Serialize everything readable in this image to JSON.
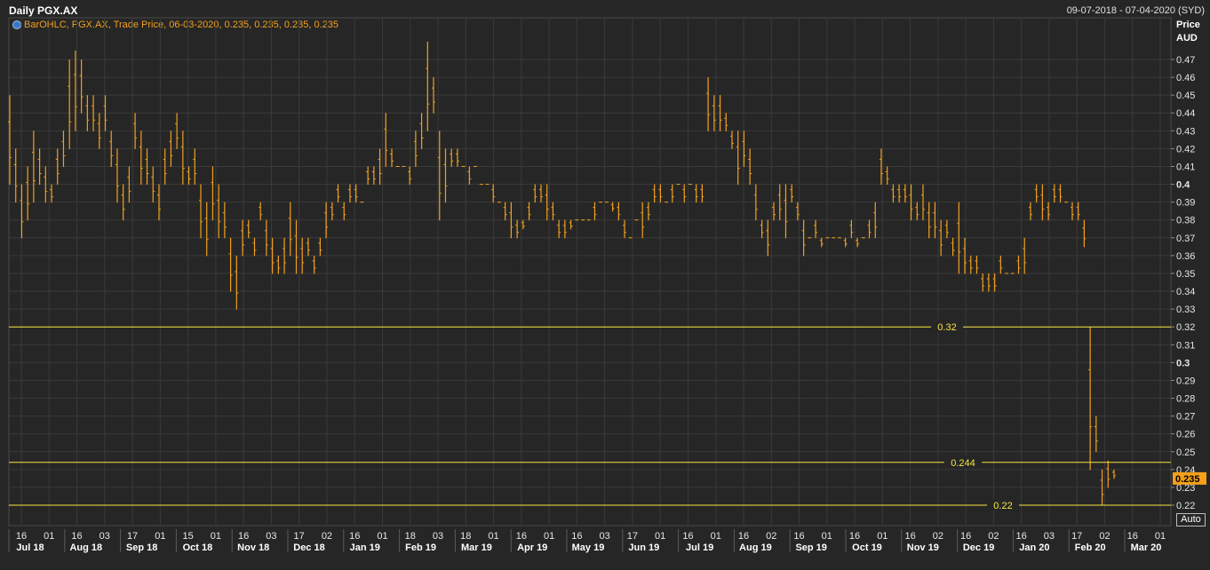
{
  "header": {
    "title": "Daily PGX.AX",
    "date_range": "09-07-2018 - 07-04-2020 (SYD)"
  },
  "legend": {
    "text": "BarOHLC, PGX.AX, Trade Price, 06-03-2020, 0.235, 0.235, 0.235, 0.235"
  },
  "axis": {
    "price_label": "Price",
    "currency_label": "AUD",
    "auto_label": "Auto"
  },
  "colors": {
    "background": "#262626",
    "grid": "#3a3a3a",
    "bars": "#f2a01f",
    "hlines": "#f5e642",
    "current_tag": "#f5a01a"
  },
  "chart_data": {
    "type": "ohlc-bar",
    "title": "Daily PGX.AX",
    "ylabel": "Price AUD",
    "ylim": [
      0.215,
      0.485
    ],
    "y_ticks": [
      "0.47",
      "0.46",
      "0.45",
      "0.44",
      "0.43",
      "0.42",
      "0.41",
      "0.4",
      "0.39",
      "0.38",
      "0.37",
      "0.36",
      "0.35",
      "0.34",
      "0.33",
      "0.32",
      "0.31",
      "0.3",
      "0.29",
      "0.28",
      "0.27",
      "0.26",
      "0.25",
      "0.24",
      "0.23",
      "0.22"
    ],
    "bold_ticks": [
      "0.4",
      "0.3"
    ],
    "x_day_ticks": [
      "16",
      "01",
      "16",
      "03",
      "17",
      "01",
      "15",
      "01",
      "16",
      "03",
      "17",
      "02",
      "16",
      "01",
      "18",
      "03",
      "18",
      "01",
      "16",
      "01",
      "16",
      "03",
      "17",
      "01",
      "16",
      "01",
      "16",
      "02",
      "16",
      "01",
      "16",
      "01",
      "16",
      "02",
      "16",
      "02",
      "16",
      "03",
      "17",
      "02",
      "16",
      "01"
    ],
    "x_month_labels": [
      "Jul 18",
      "Aug 18",
      "Sep 18",
      "Oct 18",
      "Nov 18",
      "Dec 18",
      "Jan 19",
      "Feb 19",
      "Mar 19",
      "Apr 19",
      "May 19",
      "Jun 19",
      "Jul 19",
      "Aug 19",
      "Sep 19",
      "Oct 19",
      "Nov 19",
      "Dec 19",
      "Jan 20",
      "Feb 20",
      "Mar 20"
    ],
    "horizontal_lines": [
      {
        "label": "0.32",
        "value": 0.32
      },
      {
        "label": "0.244",
        "value": 0.244
      },
      {
        "label": "0.22",
        "value": 0.22
      }
    ],
    "last_price": "0.235",
    "series": [
      {
        "name": "PGX.AX",
        "points": [
          [
            0.45,
            0.4
          ],
          [
            0.42,
            0.39
          ],
          [
            0.4,
            0.37
          ],
          [
            0.41,
            0.38
          ],
          [
            0.43,
            0.39
          ],
          [
            0.42,
            0.4
          ],
          [
            0.41,
            0.39
          ],
          [
            0.4,
            0.39
          ],
          [
            0.42,
            0.4
          ],
          [
            0.43,
            0.41
          ],
          [
            0.47,
            0.42
          ],
          [
            0.475,
            0.43
          ],
          [
            0.47,
            0.44
          ],
          [
            0.45,
            0.43
          ],
          [
            0.45,
            0.43
          ],
          [
            0.44,
            0.42
          ],
          [
            0.45,
            0.43
          ],
          [
            0.43,
            0.41
          ],
          [
            0.42,
            0.39
          ],
          [
            0.4,
            0.38
          ],
          [
            0.41,
            0.39
          ],
          [
            0.44,
            0.42
          ],
          [
            0.43,
            0.4
          ],
          [
            0.42,
            0.4
          ],
          [
            0.41,
            0.39
          ],
          [
            0.4,
            0.38
          ],
          [
            0.42,
            0.4
          ],
          [
            0.43,
            0.41
          ],
          [
            0.44,
            0.42
          ],
          [
            0.43,
            0.4
          ],
          [
            0.41,
            0.4
          ],
          [
            0.42,
            0.4
          ],
          [
            0.4,
            0.37
          ],
          [
            0.39,
            0.36
          ],
          [
            0.41,
            0.38
          ],
          [
            0.4,
            0.37
          ],
          [
            0.39,
            0.37
          ],
          [
            0.37,
            0.34
          ],
          [
            0.36,
            0.33
          ],
          [
            0.38,
            0.36
          ],
          [
            0.38,
            0.37
          ],
          [
            0.37,
            0.36
          ],
          [
            0.39,
            0.38
          ],
          [
            0.38,
            0.36
          ],
          [
            0.37,
            0.35
          ],
          [
            0.36,
            0.35
          ],
          [
            0.37,
            0.35
          ],
          [
            0.39,
            0.36
          ],
          [
            0.38,
            0.35
          ],
          [
            0.37,
            0.35
          ],
          [
            0.37,
            0.36
          ],
          [
            0.36,
            0.35
          ],
          [
            0.37,
            0.36
          ],
          [
            0.39,
            0.37
          ],
          [
            0.39,
            0.38
          ],
          [
            0.4,
            0.39
          ],
          [
            0.39,
            0.38
          ],
          [
            0.4,
            0.39
          ],
          [
            0.4,
            0.39
          ],
          [
            0.39,
            0.39
          ],
          [
            0.41,
            0.4
          ],
          [
            0.41,
            0.4
          ],
          [
            0.42,
            0.4
          ],
          [
            0.44,
            0.41
          ],
          [
            0.42,
            0.41
          ],
          [
            0.41,
            0.41
          ],
          [
            0.41,
            0.41
          ],
          [
            0.41,
            0.4
          ],
          [
            0.43,
            0.41
          ],
          [
            0.44,
            0.42
          ],
          [
            0.48,
            0.43
          ],
          [
            0.46,
            0.44
          ],
          [
            0.43,
            0.38
          ],
          [
            0.42,
            0.39
          ],
          [
            0.42,
            0.41
          ],
          [
            0.42,
            0.41
          ],
          [
            0.41,
            0.41
          ],
          [
            0.41,
            0.4
          ],
          [
            0.41,
            0.41
          ],
          [
            0.4,
            0.4
          ],
          [
            0.4,
            0.4
          ],
          [
            0.4,
            0.39
          ],
          [
            0.39,
            0.39
          ],
          [
            0.39,
            0.38
          ],
          [
            0.39,
            0.37
          ],
          [
            0.38,
            0.37
          ],
          [
            0.38,
            0.375
          ],
          [
            0.39,
            0.38
          ],
          [
            0.4,
            0.39
          ],
          [
            0.4,
            0.39
          ],
          [
            0.4,
            0.38
          ],
          [
            0.39,
            0.38
          ],
          [
            0.38,
            0.37
          ],
          [
            0.38,
            0.37
          ],
          [
            0.38,
            0.375
          ],
          [
            0.38,
            0.38
          ],
          [
            0.38,
            0.38
          ],
          [
            0.38,
            0.38
          ],
          [
            0.39,
            0.38
          ],
          [
            0.39,
            0.39
          ],
          [
            0.39,
            0.39
          ],
          [
            0.39,
            0.385
          ],
          [
            0.39,
            0.38
          ],
          [
            0.38,
            0.37
          ],
          [
            0.37,
            0.37
          ],
          [
            0.38,
            0.38
          ],
          [
            0.39,
            0.37
          ],
          [
            0.39,
            0.38
          ],
          [
            0.4,
            0.39
          ],
          [
            0.4,
            0.39
          ],
          [
            0.39,
            0.39
          ],
          [
            0.4,
            0.39
          ],
          [
            0.4,
            0.4
          ],
          [
            0.4,
            0.39
          ],
          [
            0.4,
            0.4
          ],
          [
            0.4,
            0.39
          ],
          [
            0.4,
            0.39
          ],
          [
            0.46,
            0.43
          ],
          [
            0.45,
            0.43
          ],
          [
            0.45,
            0.43
          ],
          [
            0.44,
            0.43
          ],
          [
            0.43,
            0.42
          ],
          [
            0.43,
            0.4
          ],
          [
            0.43,
            0.41
          ],
          [
            0.42,
            0.4
          ],
          [
            0.4,
            0.38
          ],
          [
            0.38,
            0.37
          ],
          [
            0.38,
            0.36
          ],
          [
            0.39,
            0.38
          ],
          [
            0.4,
            0.38
          ],
          [
            0.4,
            0.37
          ],
          [
            0.4,
            0.39
          ],
          [
            0.39,
            0.38
          ],
          [
            0.38,
            0.36
          ],
          [
            0.37,
            0.37
          ],
          [
            0.38,
            0.37
          ],
          [
            0.37,
            0.365
          ],
          [
            0.37,
            0.37
          ],
          [
            0.37,
            0.37
          ],
          [
            0.37,
            0.37
          ],
          [
            0.37,
            0.365
          ],
          [
            0.38,
            0.37
          ],
          [
            0.37,
            0.365
          ],
          [
            0.37,
            0.37
          ],
          [
            0.38,
            0.37
          ],
          [
            0.39,
            0.37
          ],
          [
            0.42,
            0.4
          ],
          [
            0.41,
            0.4
          ],
          [
            0.4,
            0.39
          ],
          [
            0.4,
            0.39
          ],
          [
            0.4,
            0.39
          ],
          [
            0.4,
            0.38
          ],
          [
            0.39,
            0.38
          ],
          [
            0.4,
            0.38
          ],
          [
            0.39,
            0.37
          ],
          [
            0.39,
            0.37
          ],
          [
            0.38,
            0.36
          ],
          [
            0.38,
            0.37
          ],
          [
            0.37,
            0.36
          ],
          [
            0.39,
            0.35
          ],
          [
            0.37,
            0.35
          ],
          [
            0.36,
            0.35
          ],
          [
            0.36,
            0.35
          ],
          [
            0.35,
            0.34
          ],
          [
            0.35,
            0.34
          ],
          [
            0.35,
            0.34
          ],
          [
            0.36,
            0.35
          ],
          [
            0.35,
            0.35
          ],
          [
            0.35,
            0.35
          ],
          [
            0.36,
            0.35
          ],
          [
            0.37,
            0.35
          ],
          [
            0.39,
            0.38
          ],
          [
            0.4,
            0.39
          ],
          [
            0.4,
            0.38
          ],
          [
            0.39,
            0.38
          ],
          [
            0.4,
            0.39
          ],
          [
            0.4,
            0.39
          ],
          [
            0.39,
            0.39
          ],
          [
            0.39,
            0.38
          ],
          [
            0.39,
            0.38
          ],
          [
            0.38,
            0.365
          ],
          [
            0.32,
            0.24
          ],
          [
            0.27,
            0.25
          ],
          [
            0.24,
            0.22
          ],
          [
            0.245,
            0.23
          ],
          [
            0.24,
            0.235
          ]
        ]
      }
    ]
  }
}
